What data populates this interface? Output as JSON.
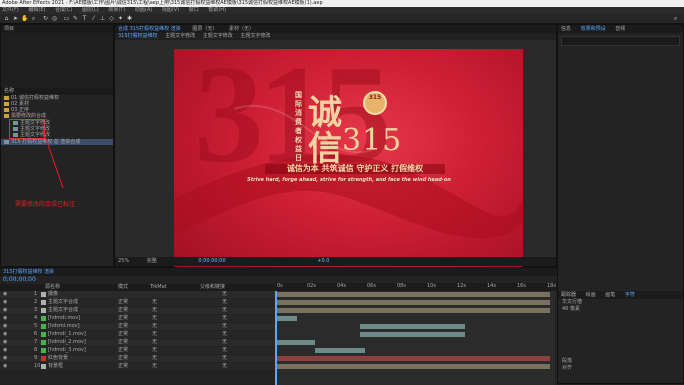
{
  "titlebar": {
    "text": "Adobe After Effects 2021 - F:\\AE模版\\工作\\图片\\诚信315\\工程\\aep上用\\315诚信打假权益维权AE模板\\315诚信打假权益维权AE模板(1).aep"
  },
  "menu": [
    "文件(F)",
    "编辑(E)",
    "合成(C)",
    "图层(L)",
    "效果(T)",
    "动画(A)",
    "视图(V)",
    "窗口",
    "帮助(H)"
  ],
  "project": {
    "tab": "项目",
    "effects_tab": "效果控件",
    "header": "名称",
    "items": [
      {
        "name": "01 诚信打假权益维权",
        "type": "folder"
      },
      {
        "name": "02 素材",
        "type": "folder"
      },
      {
        "name": "03 正序",
        "type": "folder"
      },
      {
        "name": "需要修改的合成",
        "type": "folder"
      },
      {
        "name": "主题文字修改",
        "type": "comp"
      },
      {
        "name": "主题文字修改",
        "type": "comp"
      },
      {
        "name": "主题文字修改",
        "type": "comp"
      },
      {
        "name": "315 打假权益维权 总 渲染合成",
        "type": "comp"
      }
    ],
    "annotation": "需要修改的合成已标注"
  },
  "viewer": {
    "tabs": [
      "合成 315打假权益维权 渲染",
      "图层（无）",
      "素材（无）"
    ],
    "subtabs": [
      "315打假权益维权",
      "主题文字修改",
      "主题文字修改",
      "主题文字修改"
    ],
    "zoom": "25%",
    "quality": "完整",
    "timecode": "0;00;00;00",
    "exposure": "+0.0"
  },
  "canvas": {
    "big_bg": "315",
    "vertical_text": "国际消费者权益日",
    "cheng": "诚",
    "xin": "信",
    "num": "315",
    "badge_top": "315",
    "slogan": "诚信为本 共筑诚信  守护正义 打假维权",
    "en": "Strive hard, forge ahead, strive for strength, and face the wind head-on"
  },
  "timeline": {
    "tab": "315打假权益维权 渲染",
    "timecode": "0;00;00;00",
    "col_source": "源名称",
    "col_mode": "模式",
    "col_trkmat": "TrkMat",
    "col_parent": "父级和链接",
    "ruler": [
      "0s",
      "02s",
      "04s",
      "06s",
      "08s",
      "10s",
      "12s",
      "14s",
      "16s",
      "18s"
    ],
    "layers": [
      {
        "num": "1",
        "name": "摄像",
        "mode": "",
        "trk": "",
        "parent": "无",
        "color": "#b0b0b0"
      },
      {
        "num": "2",
        "name": "主题文字合成",
        "mode": "正常",
        "trk": "无",
        "parent": "无",
        "color": "#b0b0b0"
      },
      {
        "num": "3",
        "name": "主题文字合成",
        "mode": "正常",
        "trk": "无",
        "parent": "无",
        "color": "#b0b0b0"
      },
      {
        "num": "4",
        "name": "[hdmdi.mov]",
        "mode": "正常",
        "trk": "无",
        "parent": "无",
        "color": "#4caf50"
      },
      {
        "num": "5",
        "name": "[hdsmi.mov]",
        "mode": "正常",
        "trk": "无",
        "parent": "无",
        "color": "#4caf50"
      },
      {
        "num": "6",
        "name": "[hdmdi_1.mov]",
        "mode": "正常",
        "trk": "无",
        "parent": "无",
        "color": "#4caf50"
      },
      {
        "num": "7",
        "name": "[hdmdi_2.mov]",
        "mode": "正常",
        "trk": "无",
        "parent": "无",
        "color": "#4caf50"
      },
      {
        "num": "8",
        "name": "[hdmdi_3.mov]",
        "mode": "正常",
        "trk": "无",
        "parent": "无",
        "color": "#4caf50"
      },
      {
        "num": "9",
        "name": "红色背景",
        "mode": "正常",
        "trk": "无",
        "parent": "无",
        "color": "#c0392b"
      },
      {
        "num": "10",
        "name": "背景框",
        "mode": "正常",
        "trk": "无",
        "parent": "无",
        "color": "#b0b0b0"
      }
    ]
  },
  "right_panel": {
    "tabs": [
      "信息",
      "效果和预设",
      "音频"
    ],
    "lower_tabs": [
      "跟踪器",
      "绘画",
      "画笔",
      "字符"
    ],
    "font": "华文行楷",
    "size": "46 像素",
    "items": [
      "段落",
      "对齐",
      "库"
    ]
  }
}
